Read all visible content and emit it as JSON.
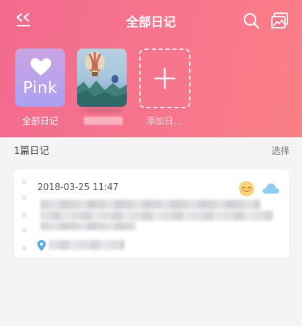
{
  "header": {
    "title": "全部日记",
    "back_icon": "double-chevron-back-icon",
    "search_icon": "search-icon",
    "gallery_icon": "gallery-icon"
  },
  "books": [
    {
      "cover_text": "Pink",
      "label": "全部日记"
    },
    {
      "label": ""
    },
    {
      "label": "添加日..."
    }
  ],
  "list": {
    "count": "1篇日记",
    "select": "选择"
  },
  "entry": {
    "date": "2018-03-25 11:47",
    "mood_icon": "smiling-face-icon",
    "weather_icon": "cloud-icon",
    "location_icon": "location-pin-icon"
  },
  "colors": {
    "header_start": "#f26a8f",
    "header_end": "#fb7f86",
    "background": "#f4f4f6"
  }
}
